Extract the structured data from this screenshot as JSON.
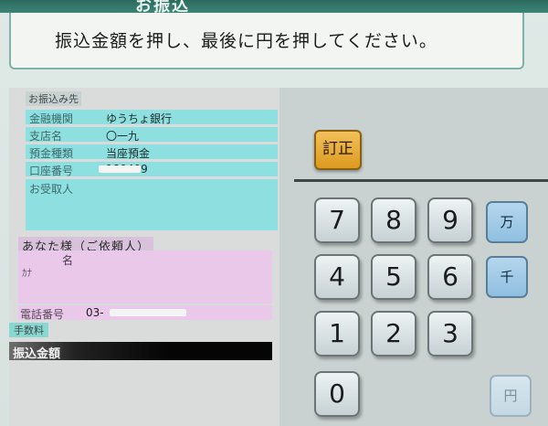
{
  "header": {
    "title": "お振込",
    "instruction": "振込金額を押し、最後に円を押してください。"
  },
  "transfer": {
    "section_label": "お振込み先",
    "fields": [
      {
        "label": "金融機関",
        "value": "ゆうちょ銀行"
      },
      {
        "label": "支店名",
        "value": "〇一九"
      },
      {
        "label": "預金種類",
        "value": "当座預金"
      },
      {
        "label": "口座番号",
        "value": "180409"
      }
    ],
    "recipient_label": "お受取人"
  },
  "sender": {
    "section_label": "あなた様（ご依頼人）",
    "name_label": "名",
    "name_value": "ｶﾅ",
    "phone_label": "電話番号",
    "phone_value": "03-"
  },
  "fee": {
    "label": "手数料"
  },
  "amount": {
    "label": "振込金額"
  },
  "keypad": {
    "correct": "訂正",
    "keys": [
      "7",
      "8",
      "9",
      "4",
      "5",
      "6",
      "1",
      "2",
      "3",
      "0"
    ],
    "units": {
      "man": "万",
      "sen": "千",
      "yen": "円"
    }
  },
  "colors": {
    "field_bg": "#8edfe0",
    "sender_bg": "#e9c8ea",
    "correct_button": "#e9a83a",
    "unit_key": "#9fc9e7"
  }
}
